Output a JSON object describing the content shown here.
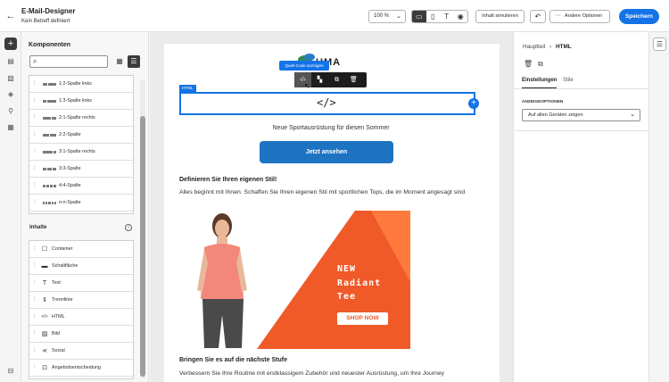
{
  "header": {
    "title": "E-Mail-Designer",
    "subtitle": "Kein Betreff definiert",
    "zoom": "100 %",
    "simulate_label": "Inhalt simulieren",
    "more_label": "Andere Optionen",
    "save_label": "Speichern"
  },
  "components": {
    "title": "Komponenten",
    "layouts": [
      {
        "label": "1:2-Spalte links",
        "bars": [
          1,
          2
        ]
      },
      {
        "label": "1:3-Spalte links",
        "bars": [
          1,
          3
        ]
      },
      {
        "label": "2:1-Spalte rechts",
        "bars": [
          2,
          1
        ]
      },
      {
        "label": "2:2-Spalte",
        "bars": [
          1,
          1
        ]
      },
      {
        "label": "3:1-Spalte rechts",
        "bars": [
          3,
          1
        ]
      },
      {
        "label": "3:3-Spalte",
        "bars": [
          1,
          1,
          1
        ]
      },
      {
        "label": "4:4-Spalte",
        "bars": [
          1,
          1,
          1,
          1
        ]
      },
      {
        "label": "n:n-Spalte",
        "bars": [
          1,
          1,
          1,
          1,
          1
        ]
      }
    ],
    "inhalte_title": "Inhalte",
    "content_items": [
      {
        "label": "Container",
        "icon": "container-icon",
        "glyph": "☐"
      },
      {
        "label": "Schaltfläche",
        "icon": "button-icon",
        "glyph": "▬"
      },
      {
        "label": "Text",
        "icon": "text-icon",
        "glyph": "T"
      },
      {
        "label": "Trennlinie",
        "icon": "divider-icon",
        "glyph": "⇕"
      },
      {
        "label": "HTML",
        "icon": "html-icon",
        "glyph": "</>"
      },
      {
        "label": "Bild",
        "icon": "image-icon",
        "glyph": "▨"
      },
      {
        "label": "Social",
        "icon": "social-icon",
        "glyph": "⋖"
      },
      {
        "label": "Angebotsentscheidung",
        "icon": "offer-icon",
        "glyph": "⊡"
      }
    ]
  },
  "canvas": {
    "logo_text": "UMA",
    "tooltip": "Quell-Code anzeigen",
    "html_tag": "HTML",
    "html_code_glyph": "</>",
    "subheading": "Neue Sportausrüstung für diesen Sommer",
    "cta_label": "Jetzt ansehen",
    "section1_heading": "Definieren Sie Ihren eigenen Stil!",
    "section1_text": "Alles beginnt mit Ihnen. Schaffen Sie Ihren eigenen Stil mit sportlichen Tops, die im Moment angesagt sind",
    "promo_lines": [
      "NEW",
      "Radiant",
      "Tee"
    ],
    "promo_button": "SHOP NOW",
    "section2_heading": "Bringen Sie es auf die nächste Stufe",
    "section2_text": "Verbessern Sie Ihre Routine mit erstklassigem Zubehör und neuester Ausrüstung, um Ihre Journey"
  },
  "properties": {
    "breadcrumb_parent": "Hauptteil",
    "breadcrumb_current": "HTML",
    "tab_settings": "Einstellungen",
    "tab_styles": "Stile",
    "display_options_label": "ANZEIGEOPTIONEN",
    "display_select": "Auf allen Geräten zeigen"
  },
  "colors": {
    "accent": "#1473e6",
    "cta": "#1e73c3",
    "promo_orange": "#f05a28"
  }
}
